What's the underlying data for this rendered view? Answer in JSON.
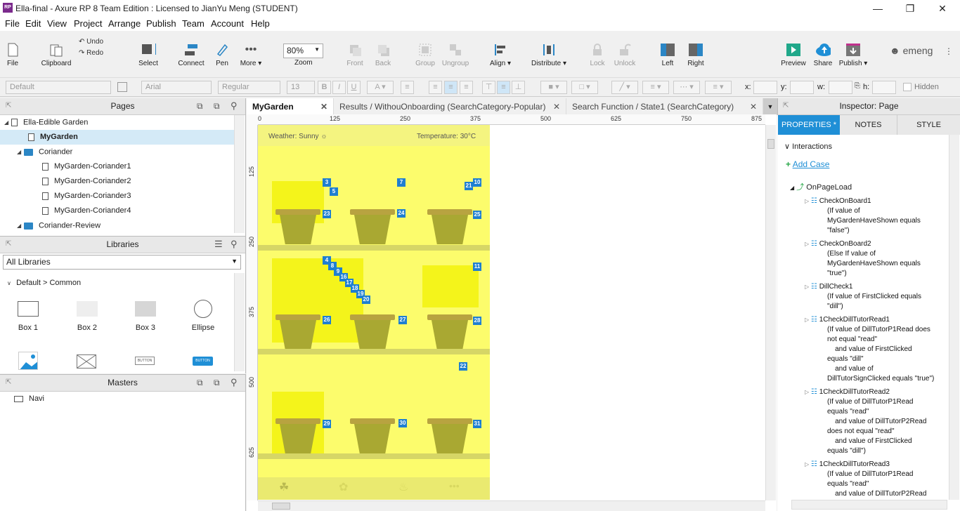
{
  "window": {
    "title": "Ella-final - Axure RP 8 Team Edition : Licensed to JianYu Meng (STUDENT)",
    "app_icon": "RP"
  },
  "menu": [
    "File",
    "Edit",
    "View",
    "Project",
    "Arrange",
    "Publish",
    "Team",
    "Account",
    "Help"
  ],
  "toolbar": {
    "file": "File",
    "clipboard": "Clipboard",
    "undo": "Undo",
    "redo": "Redo",
    "select": "Select",
    "connect": "Connect",
    "pen": "Pen",
    "more": "More ▾",
    "zoom_value": "80%",
    "zoom": "Zoom",
    "front": "Front",
    "back": "Back",
    "group": "Group",
    "ungroup": "Ungroup",
    "align": "Align ▾",
    "distribute": "Distribute ▾",
    "lock": "Lock",
    "unlock": "Unlock",
    "left": "Left",
    "right": "Right",
    "preview": "Preview",
    "share": "Share",
    "publish": "Publish ▾",
    "user": "emeng"
  },
  "format": {
    "style": "Default",
    "font": "Arial",
    "weight": "Regular",
    "size": "13",
    "x": "x:",
    "y": "y:",
    "w": "w:",
    "h": "h:",
    "hidden": "Hidden"
  },
  "pages": {
    "title": "Pages",
    "items": [
      {
        "label": "Ella-Edible Garden",
        "type": "doc"
      },
      {
        "label": "MyGarden",
        "type": "doc"
      },
      {
        "label": "Coriander",
        "type": "folder"
      },
      {
        "label": "MyGarden-Coriander1",
        "type": "doc"
      },
      {
        "label": "MyGarden-Coriander2",
        "type": "doc"
      },
      {
        "label": "MyGarden-Coriander3",
        "type": "doc"
      },
      {
        "label": "MyGarden-Coriander4",
        "type": "doc"
      },
      {
        "label": "Coriander-Review",
        "type": "folder"
      }
    ]
  },
  "libraries": {
    "title": "Libraries",
    "select": "All Libraries",
    "group": "Default > Common",
    "items": [
      "Box 1",
      "Box 2",
      "Box 3",
      "Ellipse"
    ],
    "button_word": "BUTTON"
  },
  "masters": {
    "title": "Masters",
    "items": [
      "Navi"
    ]
  },
  "tabs": [
    {
      "label": "MyGarden"
    },
    {
      "label": "Results / WithouOnboarding (SearchCategory-Popular)"
    },
    {
      "label": "Search Function / State1 (SearchCategory)"
    }
  ],
  "ruler_h": [
    "0",
    "125",
    "250",
    "375",
    "500",
    "625",
    "750",
    "875"
  ],
  "ruler_v": [
    "125",
    "250",
    "375",
    "500",
    "625"
  ],
  "design": {
    "weather": "Weather: Sunny",
    "temperature": "Temperature: 30°C",
    "badges": [
      "3",
      "5",
      "7",
      "21",
      "10",
      "23",
      "24",
      "25",
      "4",
      "8",
      "9",
      "16",
      "17",
      "18",
      "19",
      "20",
      "11",
      "26",
      "27",
      "28",
      "22",
      "29",
      "30",
      "31"
    ]
  },
  "inspector": {
    "title": "Inspector: Page",
    "tabs": [
      "PROPERTIES *",
      "NOTES",
      "STYLE"
    ],
    "interactions": "Interactions",
    "add_case": "Add Case",
    "event": "OnPageLoad",
    "cases": [
      {
        "name": "CheckOnBoard1",
        "cond": "(If value of\nMyGardenHaveShown equals\n\"false\")"
      },
      {
        "name": "CheckOnBoard2",
        "cond": "(Else If value of\nMyGardenHaveShown equals\n\"true\")"
      },
      {
        "name": "DillCheck1",
        "cond": "(If value of FirstClicked equals\n\"dill\")"
      },
      {
        "name": "1CheckDillTutorRead1",
        "cond": "(If value of DillTutorP1Read does\nnot equal \"read\"\n    and value of FirstClicked\nequals \"dill\"\n    and value of\nDillTutorSignClicked equals \"true\")"
      },
      {
        "name": "1CheckDillTutorRead2",
        "cond": "(If value of DillTutorP1Read\nequals \"read\"\n    and value of DillTutorP2Read\ndoes not equal \"read\"\n    and value of FirstClicked\nequals \"dill\")"
      },
      {
        "name": "1CheckDillTutorRead3",
        "cond": "(If value of DillTutorP1Read\nequals \"read\"\n    and value of DillTutorP2Read"
      }
    ]
  },
  "colors": {
    "accent": "#1f8fd6",
    "badge": "#1f7fd0",
    "canvas": "#fcfc6c"
  }
}
